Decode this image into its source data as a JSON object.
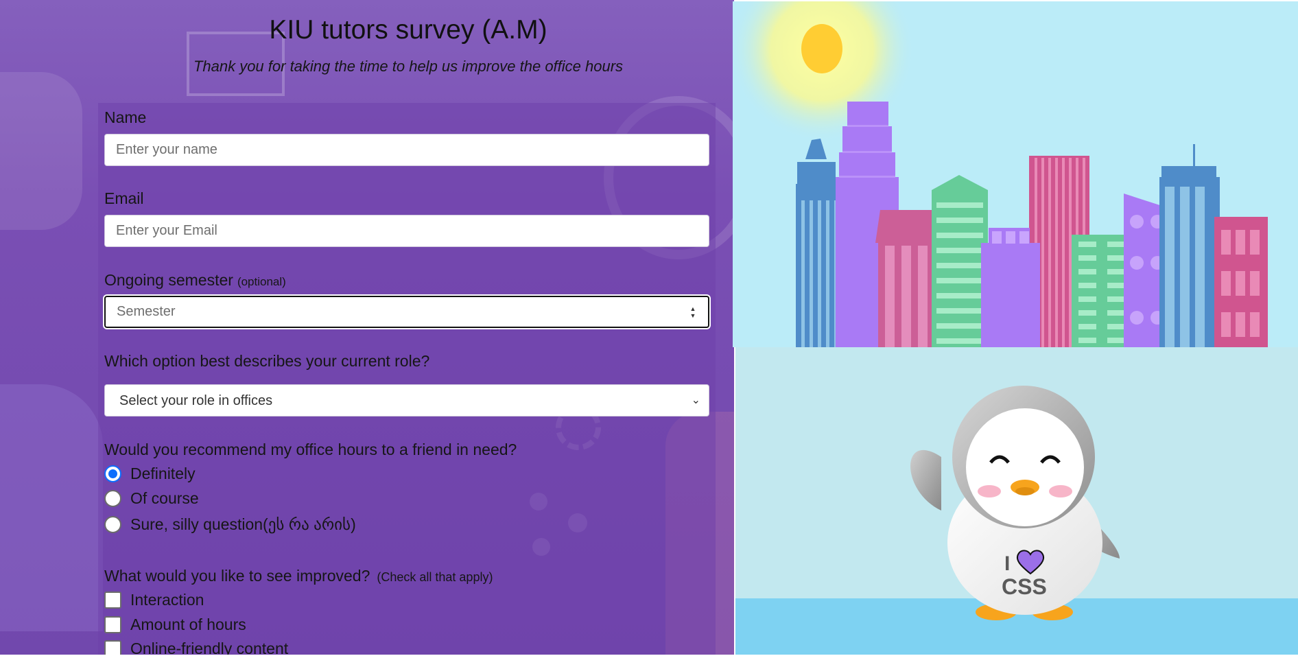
{
  "survey": {
    "title": "KIU tutors survey (A.M)",
    "subtitle": "Thank you for taking the time to help us improve the office hours",
    "name": {
      "label": "Name",
      "placeholder": "Enter your name"
    },
    "email": {
      "label": "Email",
      "placeholder": "Enter your Email"
    },
    "semester": {
      "label": "Ongoing semester",
      "note": "(optional)",
      "placeholder": "Semester"
    },
    "role": {
      "label": "Which option best describes your current role?",
      "selected": "Select your role in offices"
    },
    "recommend": {
      "question": "Would you recommend my office hours to a friend in need?",
      "options": [
        "Definitely",
        "Of course",
        "Sure, silly question(ეს რა არის)"
      ],
      "selected_index": 0
    },
    "improve": {
      "question": "What would you like to see improved?",
      "note": "(Check all that apply)",
      "options": [
        "Interaction",
        "Amount of hours",
        "Online-friendly content"
      ]
    }
  },
  "penguin": {
    "shirt_line1": "I",
    "shirt_line2": "CSS"
  },
  "colors": {
    "survey_background": "#7a4fb4",
    "radio_accent": "#0d6efd",
    "sky": "#bbecf8",
    "sun": "#ffcd33",
    "heart": "#9b6fe8"
  }
}
